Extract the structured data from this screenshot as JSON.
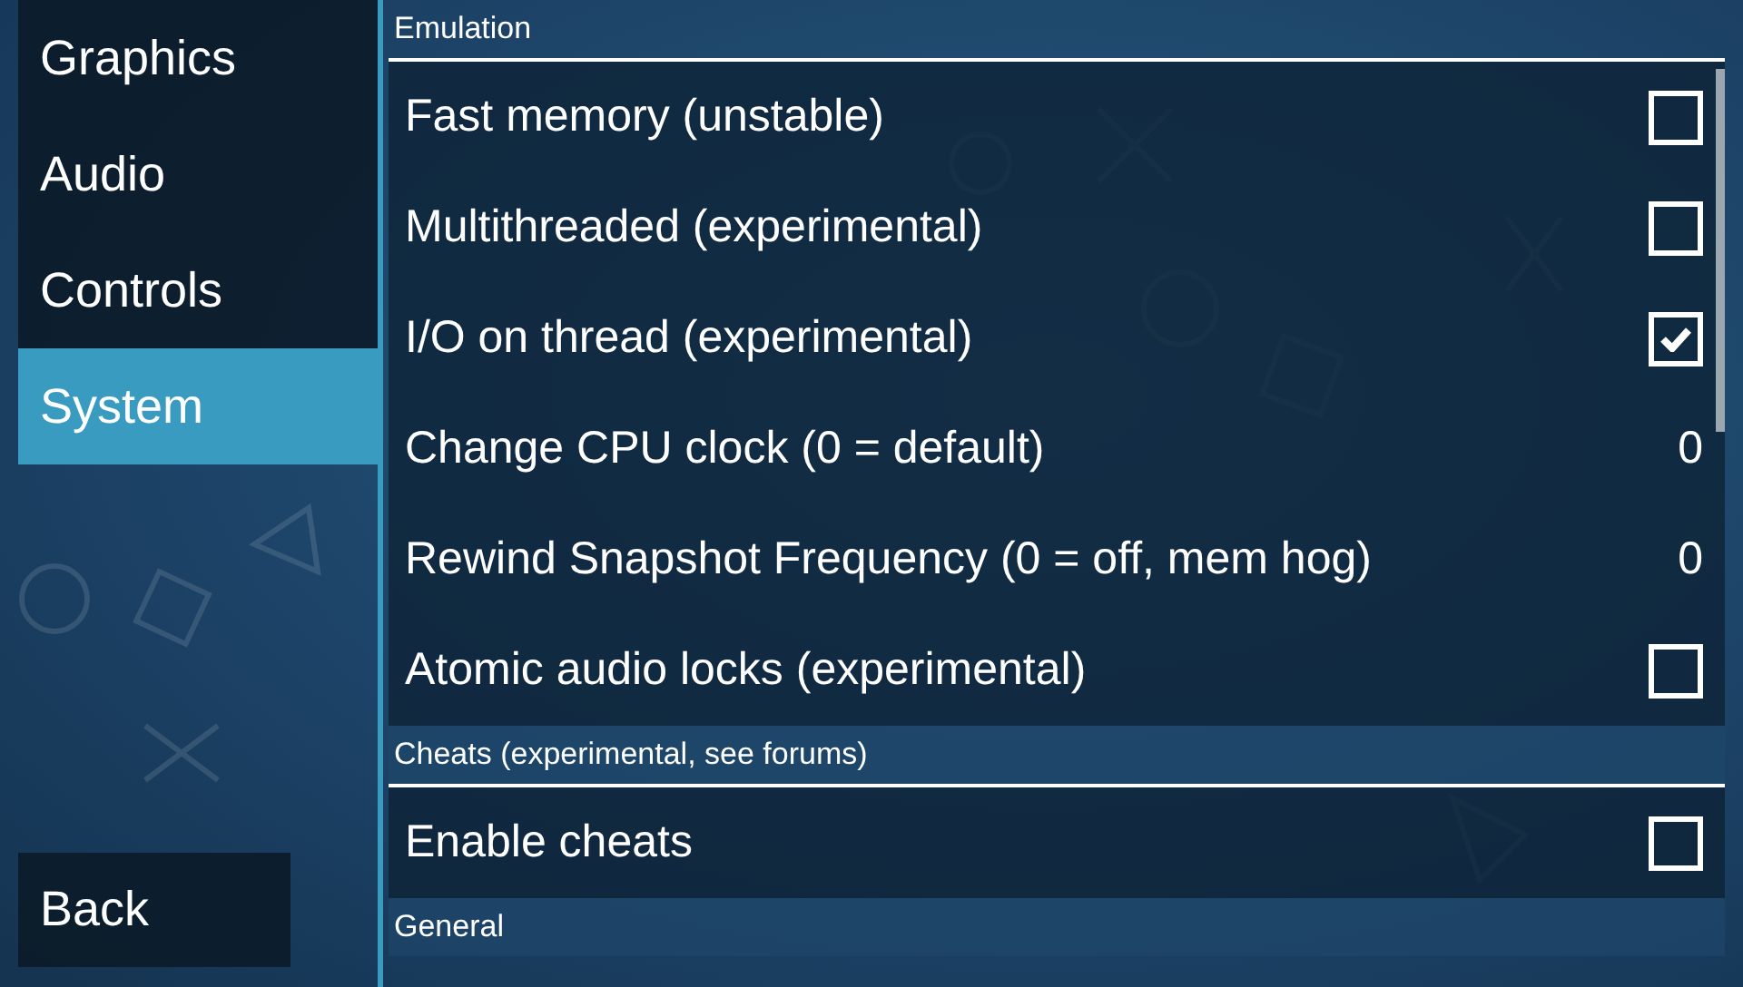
{
  "sidebar": {
    "items": [
      {
        "label": "Graphics",
        "selected": false
      },
      {
        "label": "Audio",
        "selected": false
      },
      {
        "label": "Controls",
        "selected": false
      },
      {
        "label": "System",
        "selected": true
      }
    ],
    "back_button": "Back"
  },
  "sections": [
    {
      "title": "Emulation",
      "items": [
        {
          "kind": "checkbox",
          "label": "Fast memory (unstable)",
          "checked": false
        },
        {
          "kind": "checkbox",
          "label": "Multithreaded (experimental)",
          "checked": false
        },
        {
          "kind": "checkbox",
          "label": "I/O on thread (experimental)",
          "checked": true
        },
        {
          "kind": "value",
          "label": "Change CPU clock (0 = default)",
          "value": "0"
        },
        {
          "kind": "value",
          "label": "Rewind Snapshot Frequency (0 = off, mem hog)",
          "value": "0"
        },
        {
          "kind": "checkbox",
          "label": "Atomic audio locks (experimental)",
          "checked": false
        }
      ]
    },
    {
      "title": "Cheats (experimental, see forums)",
      "items": [
        {
          "kind": "checkbox",
          "label": "Enable cheats",
          "checked": false
        }
      ]
    },
    {
      "title": "General"
    }
  ]
}
